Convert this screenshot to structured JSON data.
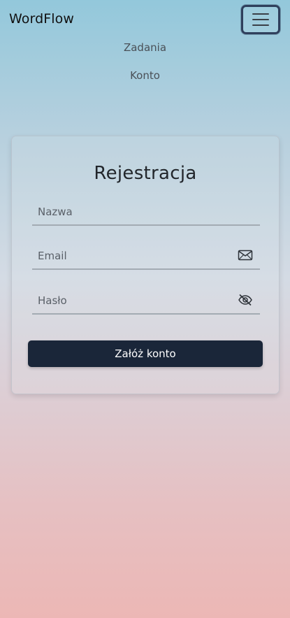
{
  "navbar": {
    "brand": "WordFlow",
    "toggler_icon": "hamburger-menu-icon",
    "links": [
      "Zadania",
      "Konto"
    ]
  },
  "form": {
    "title": "Rejestracja",
    "name_placeholder": "Nazwa",
    "email_placeholder": "Email",
    "email_icon": "envelope-icon",
    "password_placeholder": "Hasło",
    "password_icon": "eye-slash-icon",
    "submit_label": "Załóż konto"
  },
  "colors": {
    "gradient_top": "#93c8db",
    "gradient_bottom": "#ecb7b5",
    "button": "#1a2639",
    "toggler_border": "#2f3f5c"
  }
}
